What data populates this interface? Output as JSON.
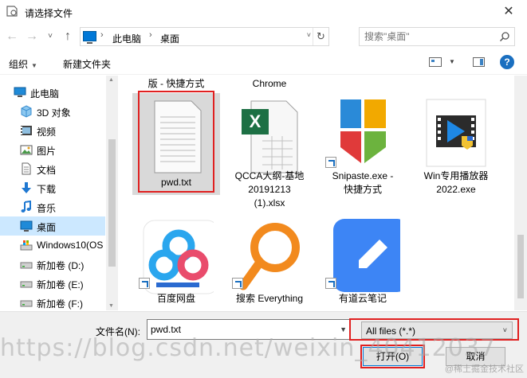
{
  "window": {
    "title": "请选择文件",
    "close_glyph": "✕"
  },
  "nav": {
    "back_glyph": "←",
    "forward_glyph": "→",
    "dropdown_glyph": "˅",
    "up_glyph": "↑",
    "address_segments": [
      "此电脑",
      "桌面"
    ],
    "refresh_glyph": "↻",
    "search_placeholder": "搜索\"桌面\""
  },
  "toolbar": {
    "organize": "组织",
    "new_folder": "新建文件夹",
    "help": "?"
  },
  "sidebar": {
    "items": [
      {
        "label": "此电脑",
        "icon": "pc-icon"
      },
      {
        "label": "3D 对象",
        "icon": "3d-objects-icon"
      },
      {
        "label": "视频",
        "icon": "video-icon"
      },
      {
        "label": "图片",
        "icon": "pictures-icon"
      },
      {
        "label": "文档",
        "icon": "documents-icon"
      },
      {
        "label": "下载",
        "icon": "downloads-icon"
      },
      {
        "label": "音乐",
        "icon": "music-icon"
      },
      {
        "label": "桌面",
        "icon": "desktop-icon",
        "selected": true
      },
      {
        "label": "Windows10(OS",
        "icon": "drive-c-icon"
      },
      {
        "label": "新加卷 (D:)",
        "icon": "drive-icon"
      },
      {
        "label": "新加卷 (E:)",
        "icon": "drive-icon"
      },
      {
        "label": "新加卷 (F:)",
        "icon": "drive-icon"
      }
    ]
  },
  "files": {
    "partial_top": [
      "版 - 快捷方式",
      "Chrome"
    ],
    "items": [
      {
        "label": "pwd.txt",
        "icon": "text-file-icon",
        "selected": true
      },
      {
        "label": "QCCA大纲-基地20191213(1).xlsx",
        "label_lines": [
          "QCCA大纲-基地",
          "20191213",
          "(1).xlsx"
        ],
        "icon": "excel-file-icon"
      },
      {
        "label_lines": [
          "Snipaste.exe -",
          "快捷方式"
        ],
        "icon": "snipaste-icon",
        "shortcut": true
      },
      {
        "label_lines": [
          "Win专用播放器",
          "2022.exe"
        ],
        "icon": "video-player-icon"
      },
      {
        "label_lines": [
          "百度网盘"
        ],
        "icon": "baidu-netdisk-icon",
        "shortcut": true
      },
      {
        "label_lines": [
          "搜索 Everything"
        ],
        "icon": "everything-search-icon",
        "shortcut": true
      },
      {
        "label_lines": [
          "有道云笔记"
        ],
        "icon": "youdao-note-icon",
        "shortcut": true
      }
    ]
  },
  "bottom": {
    "filename_label": "文件名(N):",
    "filename_value": "pwd.txt",
    "filetype": "All files (*.*)",
    "open_label": "打开(O)",
    "cancel_label": "取消"
  },
  "watermark": "https://blog.csdn.net/weixin_40412037",
  "watermark_corner": "@稀土掘金技术社区",
  "colors": {
    "accent": "#0078d7",
    "selection": "#cce8ff",
    "annotation_red": "#e02020"
  }
}
